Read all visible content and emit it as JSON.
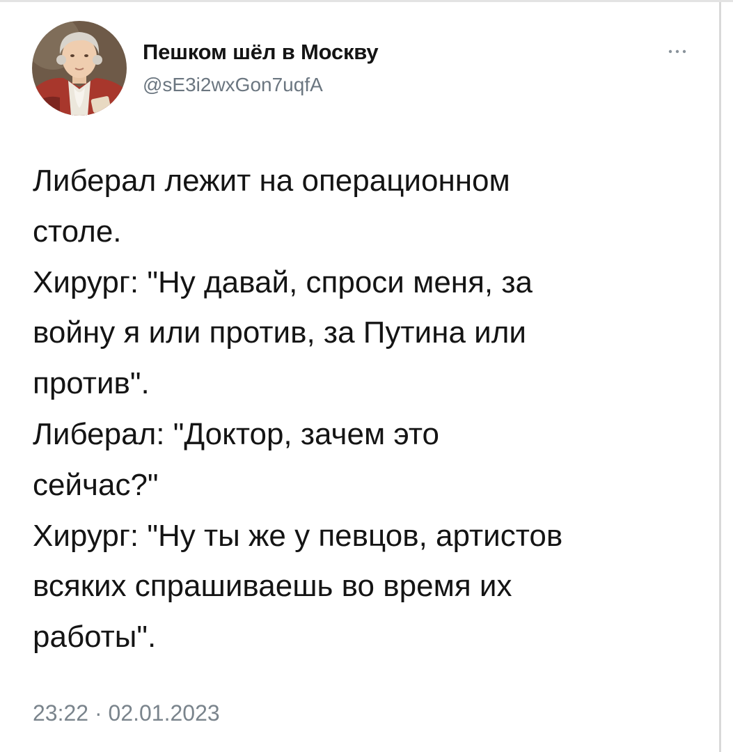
{
  "author": {
    "display_name": "Пешком шёл в Москву",
    "handle": "@sE3i2wxGon7uqfA",
    "avatar_icon": "portrait-avatar"
  },
  "more_menu_icon": "more-dots-icon",
  "tweet": {
    "lines": [
      "Либерал лежит на операционном",
      "столе.",
      "Хирург: \"Ну давай, спроси меня, за",
      "войну я или против, за Путина или",
      "против\".",
      "Либерал: \"Доктор, зачем это",
      "сейчас?\"",
      "Хирург: \"Ну ты же у певцов, артистов",
      "всяких спрашиваешь во время их",
      "работы\"."
    ]
  },
  "timestamp": "23:22 · 02.01.2023",
  "colors": {
    "text": "#141414",
    "secondary_text": "#6b7680",
    "background": "#ffffff"
  }
}
